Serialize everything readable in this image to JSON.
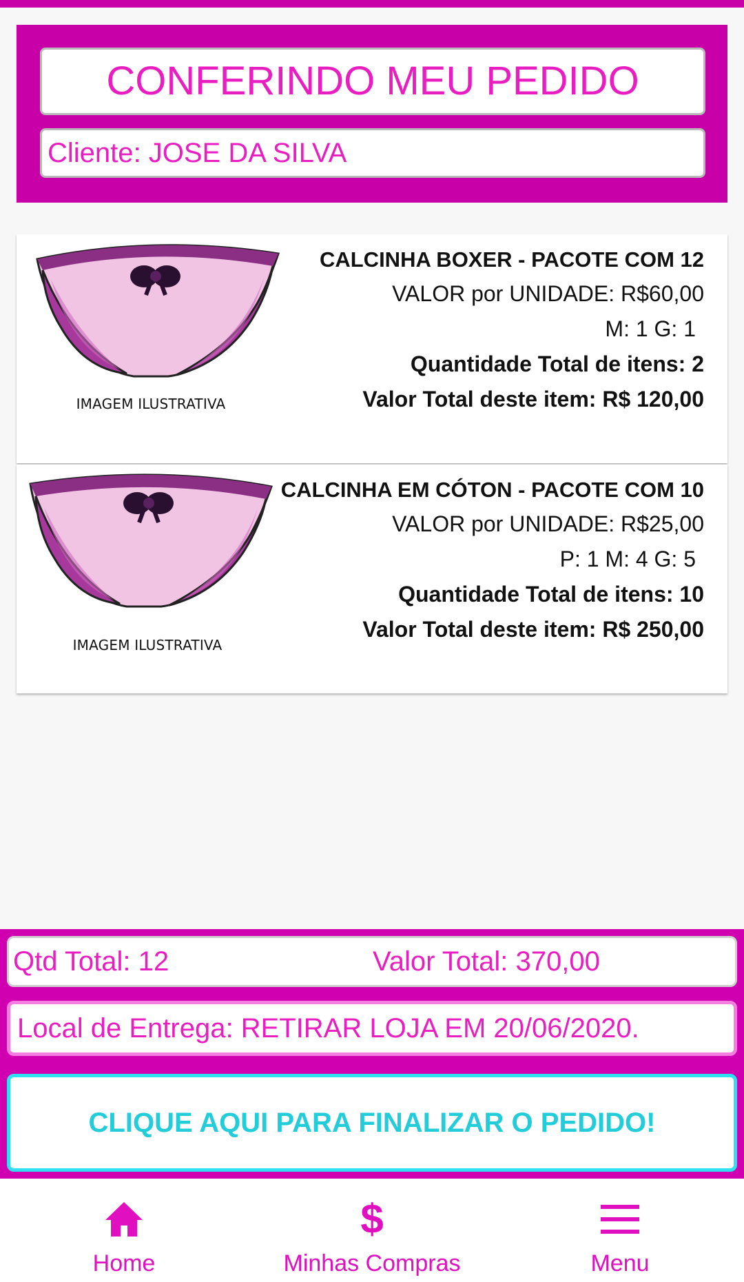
{
  "header": {
    "title": "CONFERINDO MEU PEDIDO",
    "client": "Cliente: JOSE DA SILVA"
  },
  "items": [
    {
      "image_caption": "IMAGEM ILUSTRATIVA",
      "name": "CALCINHA BOXER - PACOTE COM 12",
      "unit_price": "VALOR por UNIDADE: R$60,00",
      "sizes": "M: 1 G: 1",
      "total_qty": "Quantidade Total de itens: 2",
      "total_value": "Valor Total deste item: R$ 120,00"
    },
    {
      "image_caption": "IMAGEM ILUSTRATIVA",
      "name": "CALCINHA EM CÓTON - PACOTE COM 10",
      "unit_price": "VALOR por UNIDADE: R$25,00",
      "sizes": "P: 1 M: 4 G: 5",
      "total_qty": "Quantidade Total de itens: 10",
      "total_value": "Valor Total deste item: R$ 250,00"
    }
  ],
  "summary": {
    "qtd_total": "Qtd Total: 12",
    "valor_total": "Valor Total: 370,00",
    "delivery": "Local de Entrega: RETIRAR LOJA EM 20/06/2020.",
    "finish_button": "CLIQUE AQUI PARA FINALIZAR O PEDIDO!"
  },
  "nav": {
    "home": {
      "label": "Home",
      "icon": "home-icon"
    },
    "compras": {
      "label": "Minhas Compras",
      "icon": "dollar-icon"
    },
    "menu": {
      "label": "Menu",
      "icon": "hamburger-menu-icon"
    }
  },
  "colors": {
    "brand_magenta": "#c800a8",
    "text_pink": "#e91ec0",
    "button_cyan": "#22ccd8",
    "card_bg": "#ffffff",
    "page_bg": "#f7f7f7"
  }
}
